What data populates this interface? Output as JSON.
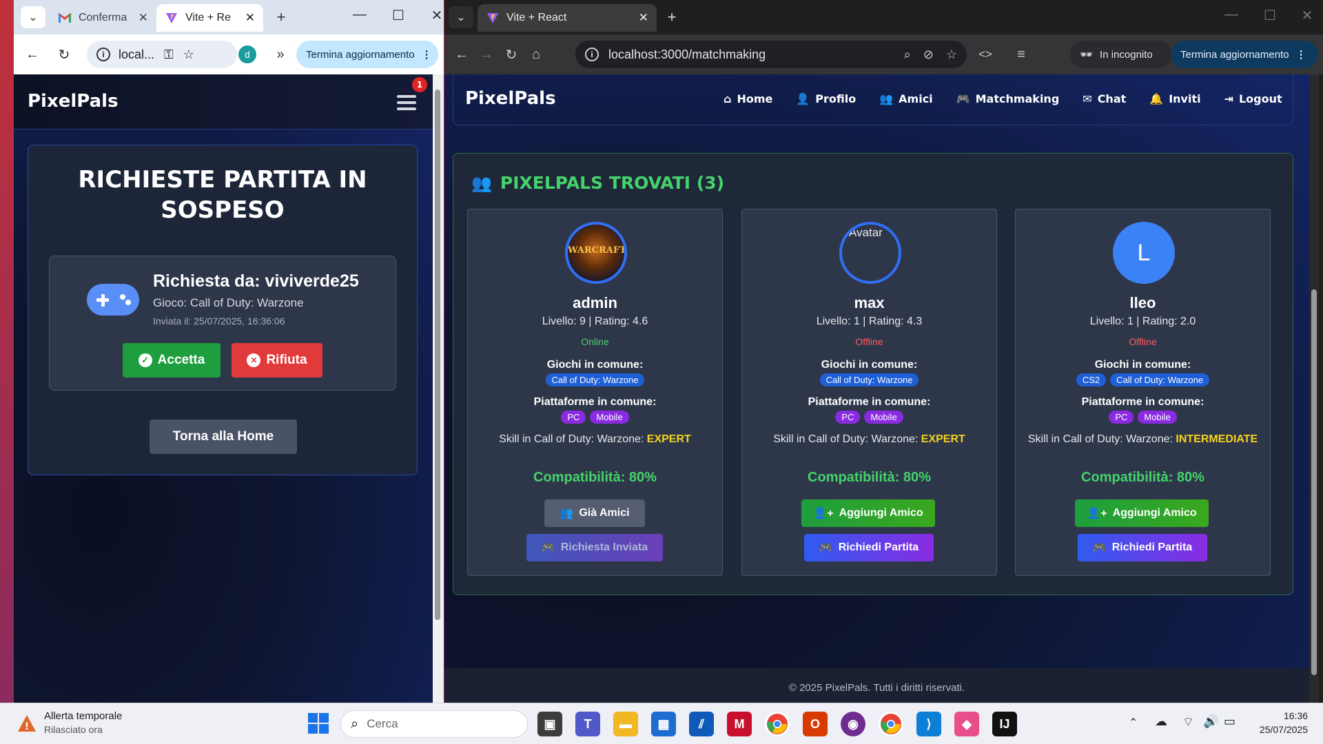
{
  "left_window": {
    "tabs": [
      {
        "label": "Conferma",
        "active": false
      },
      {
        "label": "Vite + Re",
        "active": true
      }
    ],
    "address": "local...",
    "profile_initial": "d",
    "update_button": "Termina aggiornamento",
    "app": {
      "brand": "PixelPals",
      "notification_count": "1",
      "panel_title": "RICHIESTE PARTITA IN SOSPESO",
      "request": {
        "from": "Richiesta da: viviverde25",
        "game": "Gioco: Call of Duty: Warzone",
        "sent": "Inviata il: 25/07/2025, 16:36:06",
        "accept_label": "Accetta",
        "reject_label": "Rifiuta"
      },
      "home_button": "Torna alla Home"
    }
  },
  "right_window": {
    "tab_label": "Vite + React",
    "address": "localhost:3000/matchmaking",
    "incognito_label": "In incognito",
    "update_button": "Termina aggiornamento",
    "app": {
      "brand": "PixelPals",
      "nav": [
        {
          "label": "Home",
          "icon": "home-icon"
        },
        {
          "label": "Profilo",
          "icon": "user-icon"
        },
        {
          "label": "Amici",
          "icon": "users-icon"
        },
        {
          "label": "Matchmaking",
          "icon": "gamepad-icon"
        },
        {
          "label": "Chat",
          "icon": "envelope-icon"
        },
        {
          "label": "Inviti",
          "icon": "bell-icon"
        },
        {
          "label": "Logout",
          "icon": "logout-icon"
        }
      ],
      "results_title": "PIXELPALS TROVATI (3)",
      "players": [
        {
          "name": "admin",
          "stats": "Livello: 9 | Rating: 4.6",
          "status": "Online",
          "games_heading": "Giochi in comune:",
          "games": [
            "Call of Duty: Warzone"
          ],
          "platforms_heading": "Piattaforme in comune:",
          "platforms": [
            "PC",
            "Mobile"
          ],
          "skill_prefix": "Skill in Call of Duty: Warzone:",
          "skill_level": "EXPERT",
          "compatibility": "Compatibilità: 80%",
          "primary_button": "Già Amici",
          "secondary_button": "Richiesta Inviata"
        },
        {
          "name": "max",
          "stats": "Livello: 1 | Rating: 4.3",
          "status": "Offline",
          "avatar_alt": "Avatar",
          "games_heading": "Giochi in comune:",
          "games": [
            "Call of Duty: Warzone"
          ],
          "platforms_heading": "Piattaforme in comune:",
          "platforms": [
            "PC",
            "Mobile"
          ],
          "skill_prefix": "Skill in Call of Duty: Warzone:",
          "skill_level": "EXPERT",
          "compatibility": "Compatibilità: 80%",
          "primary_button": "Aggiungi Amico",
          "secondary_button": "Richiedi Partita"
        },
        {
          "name": "lleo",
          "stats": "Livello: 1 | Rating: 2.0",
          "status": "Offline",
          "avatar_letter": "L",
          "games_heading": "Giochi in comune:",
          "games": [
            "CS2",
            "Call of Duty: Warzone"
          ],
          "platforms_heading": "Piattaforme in comune:",
          "platforms": [
            "PC",
            "Mobile"
          ],
          "skill_prefix": "Skill in Call of Duty: Warzone:",
          "skill_level": "INTERMEDIATE",
          "compatibility": "Compatibilità: 80%",
          "primary_button": "Aggiungi Amico",
          "secondary_button": "Richiedi Partita"
        }
      ],
      "footer": "© 2025 PixelPals. Tutti i diritti riservati."
    }
  },
  "taskbar": {
    "weather_title": "Allerta temporale",
    "weather_sub": "Rilasciato ora",
    "search_placeholder": "Cerca",
    "time": "16:36",
    "date": "25/07/2025"
  },
  "colors": {
    "accent_blue": "#2f6ff5",
    "success_green": "#1e9e3e",
    "danger_red": "#e23a3a",
    "online": "#44d36b",
    "offline": "#ff5b5b",
    "skill_yellow": "#f5d21e",
    "result_green": "#44d36b"
  }
}
